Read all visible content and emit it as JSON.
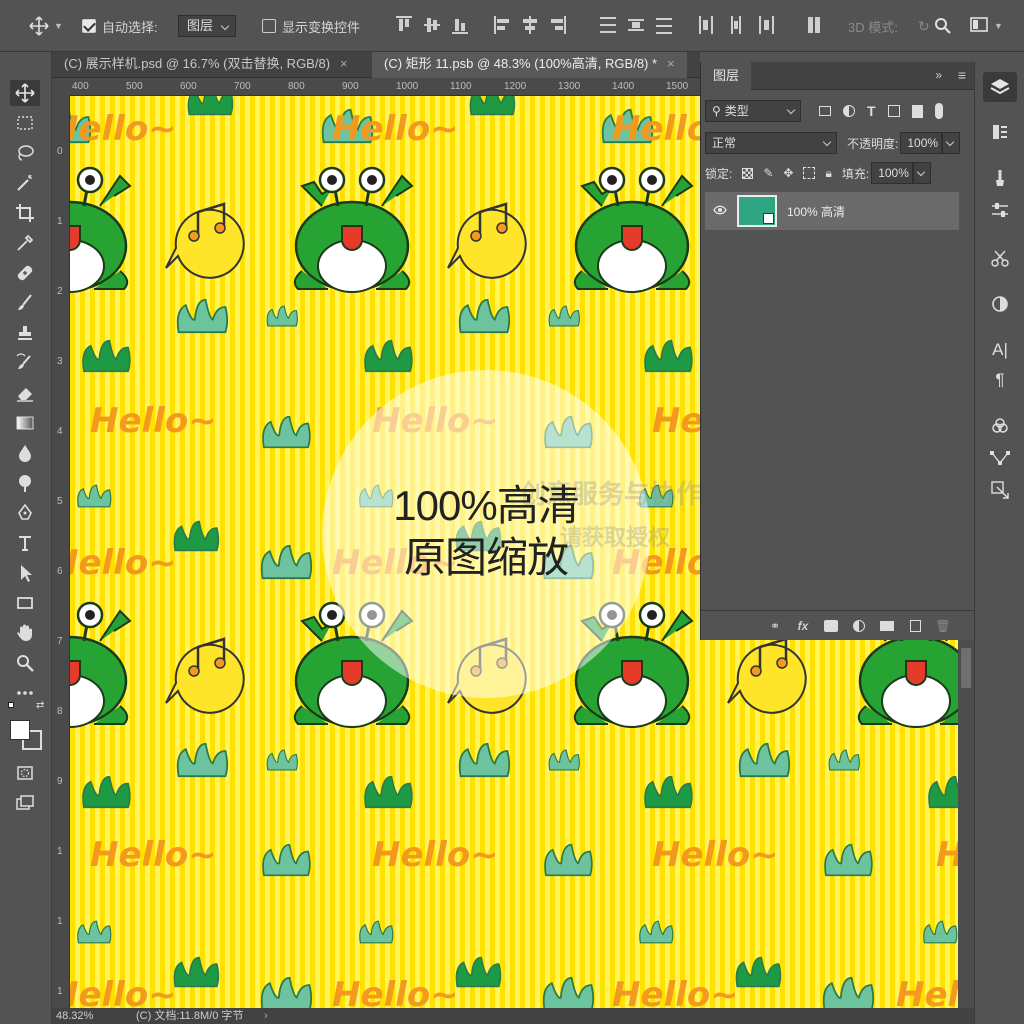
{
  "options_bar": {
    "auto_select_label": "自动选择:",
    "auto_select_checked": true,
    "auto_select_target": "图层",
    "show_transform_label": "显示变换控件",
    "mode_3d_label": "3D 模式:"
  },
  "tabs": [
    {
      "label": "(C) 展示样机.psd @ 16.7% (双击替换, RGB/8)",
      "close": "×",
      "active": false
    },
    {
      "label": "(C) 矩形 11.psb @ 48.3% (100%高清, RGB/8) *",
      "close": "×",
      "active": true
    }
  ],
  "ruler": {
    "top": [
      "400",
      "500",
      "600",
      "700",
      "800",
      "900",
      "1000",
      "1100",
      "1200",
      "1300",
      "1400",
      "1500"
    ],
    "left": [
      "0",
      "1",
      "2",
      "3",
      "4",
      "5",
      "6",
      "7",
      "8",
      "9",
      "1",
      "1",
      "1"
    ]
  },
  "layers_panel": {
    "title": "图层",
    "filter_kind": "类型",
    "blend_mode": "正常",
    "opacity_label": "不透明度:",
    "opacity_value": "100%",
    "lock_label": "锁定:",
    "fill_label": "填充:",
    "fill_value": "100%",
    "layers": [
      {
        "name": "100% 高清",
        "visible": true
      }
    ]
  },
  "canvas": {
    "hello_text": "Hello~",
    "colors": {
      "stripe_a": "#ffe100",
      "stripe_b": "#fff45e",
      "frog": "#27a334",
      "grass": "#6cc39d",
      "hello": "#f39a1e",
      "bubble": "#ffe52a"
    }
  },
  "overlay": {
    "line1": "100%高清",
    "line2": "原图缩放",
    "watermark1": "创意服务与协作平台",
    "watermark2": "请获取授权"
  },
  "status": {
    "zoom": "48.32%",
    "doc": "(C) 文档:11.8M/0 字节"
  }
}
